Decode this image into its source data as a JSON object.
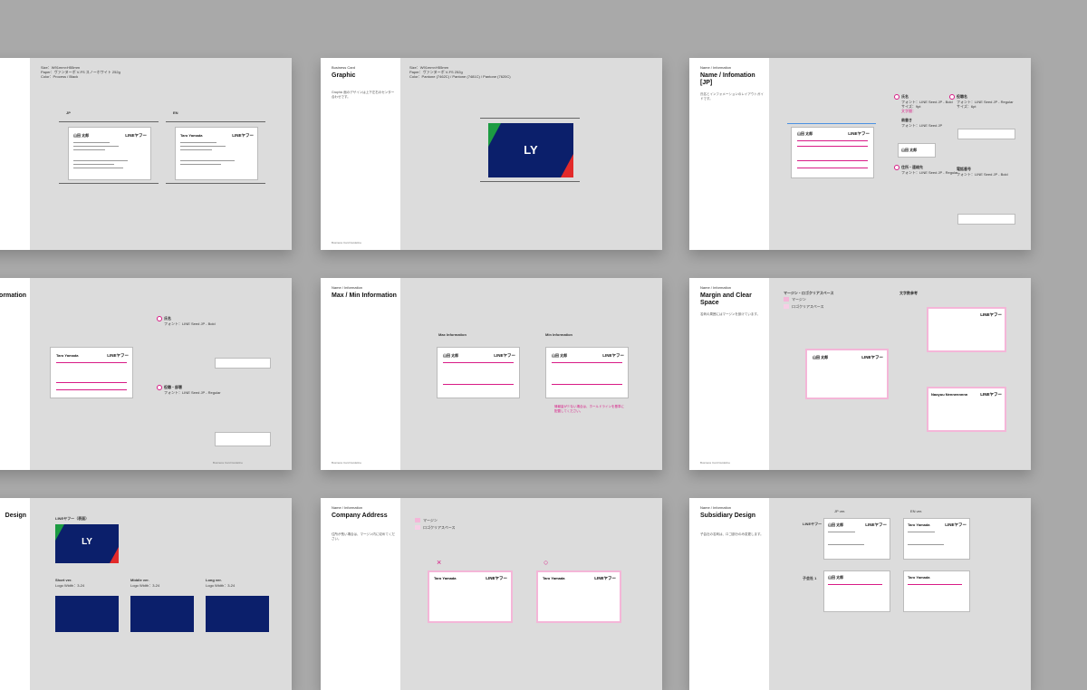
{
  "slides": {
    "s1": {
      "meta": [
        "Size：W91mm×H55mm",
        "Paper：ヴァンヌーボ V-FS スノーホワイト 252g",
        "Color：Process / Black"
      ],
      "label_jp": "JP",
      "label_en": "EN",
      "jp_name": "山田 太郎",
      "en_name": "Taro Yamada",
      "logo": "LINEヤフー"
    },
    "s2": {
      "kicker": "Business Card",
      "title": "Graphic",
      "body": "Graphic 面のデザインは上下左右のセンター合わせです。",
      "meta": [
        "Size：W91mm×H55mm",
        "Paper：ヴァンヌーボ V-FS 252g",
        "Color：Pantone (7462C) / Pantone (7481C) / Pantone (7620C)"
      ],
      "logo": "LY",
      "footer": "Business Card Guideline"
    },
    "s3": {
      "kicker": "Name / Information",
      "title": "Name / Infomation [JP]",
      "body": "氏名とインフォメーションのレイアウトガイドです。",
      "specs_left": [
        "氏名",
        "フォント：LINE Seed JP - Bold",
        "サイズ：9pt",
        "文字間：",
        "肩書き",
        "フォント：LINE Seed JP",
        "住所・連絡先",
        "フォント：LINE Seed JP - Regular"
      ],
      "specs_right": [
        "役職名",
        "フォント：LINE Seed JP - Regular",
        "サイズ：6pt",
        "電話番号",
        "フォント：LINE Seed JP - Bold"
      ],
      "name": "山田 太郎",
      "logo": "LINEヤフー"
    },
    "s4": {
      "title": "Information",
      "name": "Taro Yamada",
      "logo": "LINEヤフー",
      "specs": [
        "氏名",
        "フォント：LINE Seed JP - Bold",
        "役職・部署",
        "フォント：LINE Seed JP - Regular"
      ],
      "footer": "Business Card Guideline"
    },
    "s5": {
      "kicker": "Name / Information",
      "title": "Max / Min Information",
      "label_max": "Max Information",
      "label_min": "Min Information",
      "note": "情報量が少ない場合は、ホールドラインを基準に配置してください。",
      "footer": "Business Card Guideline",
      "name": "山田 太郎",
      "logo": "LINEヤフー"
    },
    "s6": {
      "kicker": "Name / Information",
      "title": "Margin and Clear Space",
      "legend_title": "マージン・ロゴクリアスペース",
      "legend": [
        "マージン",
        "ロゴクリアスペース"
      ],
      "right_title": "文字数参考",
      "body": "名刺の周囲にはマージンを設けています。",
      "name": "山田 太郎",
      "logo": "LINEヤフー",
      "name_en": "Naoyuu Nennennnnn",
      "footer": "Business Card Guideline"
    },
    "s7": {
      "title": "Design",
      "card_label": "LINEヤフー（表面）",
      "logo": "LY",
      "variants": [
        "Short ver.",
        "Middle ver.",
        "Long ver."
      ],
      "var_sub": [
        "Logo Width：3-24",
        "Logo Width：3-24",
        "Logo Width：3-24"
      ]
    },
    "s8": {
      "kicker": "Name / Information",
      "title": "Company Address",
      "body": "住所が長い場合は、マージン内に収めてください。",
      "legend": [
        "マージン",
        "ロゴクリアスペース"
      ],
      "marks": [
        "×",
        "○"
      ],
      "name": "Taro Yamada",
      "logo": "LINEヤフー"
    },
    "s9": {
      "kicker": "Name / Information",
      "title": "Subsidiary Design",
      "body": "子会社の名刺は、ロゴ部分のみ変更します。",
      "col_jp": "JP ver.",
      "col_en": "EN ver.",
      "row1": "LINEヤフー",
      "row2": "子会社 1",
      "name_jp": "山田 太郎",
      "name_en": "Taro Yamada",
      "logo": "LINEヤフー"
    }
  },
  "colors": {
    "bg": "#a9a9a9",
    "slide": "#dcdcdc",
    "navy": "#0b1f6b",
    "green": "#1c9b42",
    "red": "#e32a2a",
    "magenta": "#d81b86",
    "pink": "#f4b6d8"
  }
}
